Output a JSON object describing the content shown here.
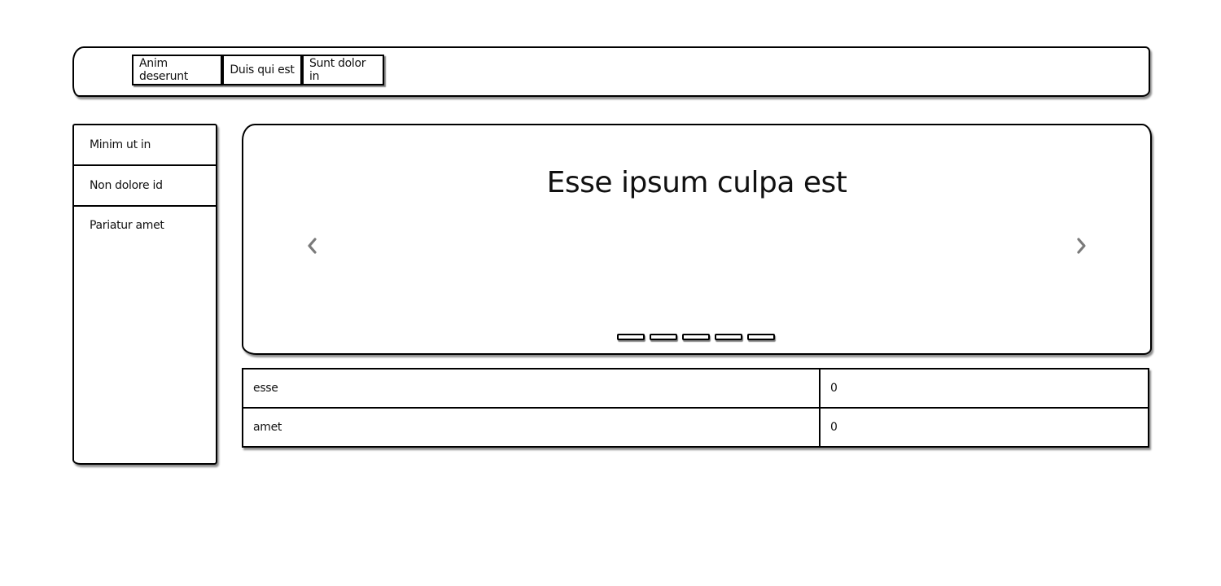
{
  "navbar": {
    "tabs": [
      {
        "label": "Anim deserunt"
      },
      {
        "label": "Duis qui est"
      },
      {
        "label": "Sunt dolor in"
      }
    ]
  },
  "sidebar": {
    "items": [
      {
        "label": "Minim ut in"
      },
      {
        "label": "Non dolore id"
      },
      {
        "label": "Pariatur amet"
      }
    ]
  },
  "carousel": {
    "title": "Esse ipsum culpa est",
    "prev_icon": "chevron-left-icon",
    "next_icon": "chevron-right-icon",
    "arrow_color": "#7a7a7a",
    "slide_count": 5
  },
  "table": {
    "rows": [
      {
        "key": "esse",
        "value": "0"
      },
      {
        "key": "amet",
        "value": "0"
      }
    ]
  }
}
